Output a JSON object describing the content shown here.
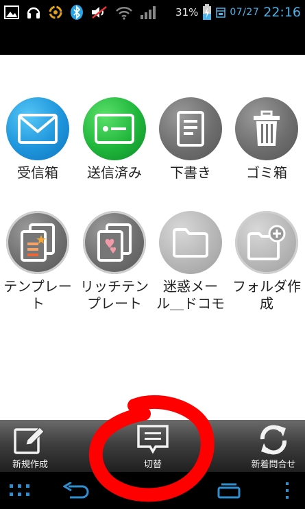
{
  "status_bar": {
    "icons": [
      "picture-icon",
      "headphones-icon",
      "sync-icon",
      "bluetooth-icon",
      "mute-icon",
      "wifi-icon",
      "signal-icon",
      "battery-charging-icon",
      "calendar-icon"
    ],
    "battery_percent": "31%",
    "date": "07/27",
    "time": "22:16"
  },
  "folders": [
    {
      "label": "受信箱",
      "icon": "mail-icon",
      "color": "#1e95dc"
    },
    {
      "label": "送信済み",
      "icon": "sent-icon",
      "color": "#1fb53b"
    },
    {
      "label": "下書き",
      "icon": "draft-icon",
      "color": "#6e6e6e"
    },
    {
      "label": "ゴミ箱",
      "icon": "trash-icon",
      "color": "#6e6e6e"
    },
    {
      "label": "テンプレー\nト",
      "icon": "template-icon",
      "color": "#6e6e6e"
    },
    {
      "label": "リッチテン\nプレート",
      "icon": "rich-template-icon",
      "color": "#6e6e6e"
    },
    {
      "label": "迷惑メー\nル＿ドコモ",
      "icon": "folder-icon",
      "color": "#b4b4b4"
    },
    {
      "label": "フォルダ作\n成",
      "icon": "add-folder-icon",
      "color": "#b4b4b4"
    }
  ],
  "action_bar": {
    "compose_label": "新規作成",
    "switch_label": "切替",
    "check_new_label": "新着問合せ"
  },
  "nav_bar": {
    "icons": [
      "menu-grid-icon",
      "back-icon",
      "home-icon",
      "recent-apps-icon",
      "overflow-menu-icon"
    ]
  },
  "annotation_color": "#ff0000"
}
